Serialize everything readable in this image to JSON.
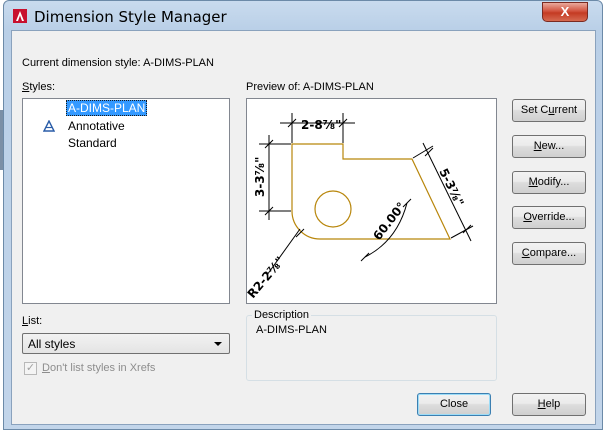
{
  "window": {
    "title": "Dimension Style Manager",
    "close_label": "X"
  },
  "current_style": {
    "label": "Current dimension style:",
    "value": "A-DIMS-PLAN"
  },
  "styles": {
    "label": "Styles:",
    "items": [
      {
        "label": "A-DIMS-PLAN",
        "selected": true,
        "icon": ""
      },
      {
        "label": "Annotative",
        "selected": false,
        "icon": "annotative-icon"
      },
      {
        "label": "Standard",
        "selected": false,
        "icon": ""
      }
    ]
  },
  "preview": {
    "label": "Preview of:",
    "value": "A-DIMS-PLAN",
    "dims": {
      "top": "2-8⅞\"",
      "left": "3-3⅞\"",
      "right": "5-3⅞\"",
      "angle": "60.00°",
      "radius": "R2-2⅞\""
    }
  },
  "list": {
    "label": "List:",
    "selected": "All styles"
  },
  "xrefs": {
    "label": "Don't list styles in Xrefs",
    "checked": true
  },
  "description": {
    "label": "Description",
    "text": "A-DIMS-PLAN"
  },
  "buttons": {
    "set_current": "Set Current",
    "new": "New...",
    "modify": "Modify...",
    "override": "Override...",
    "compare": "Compare...",
    "close": "Close",
    "help": "Help"
  },
  "colors": {
    "selection": "#3399ff",
    "shape": "#b8860b",
    "app_icon": "#c8102e"
  }
}
